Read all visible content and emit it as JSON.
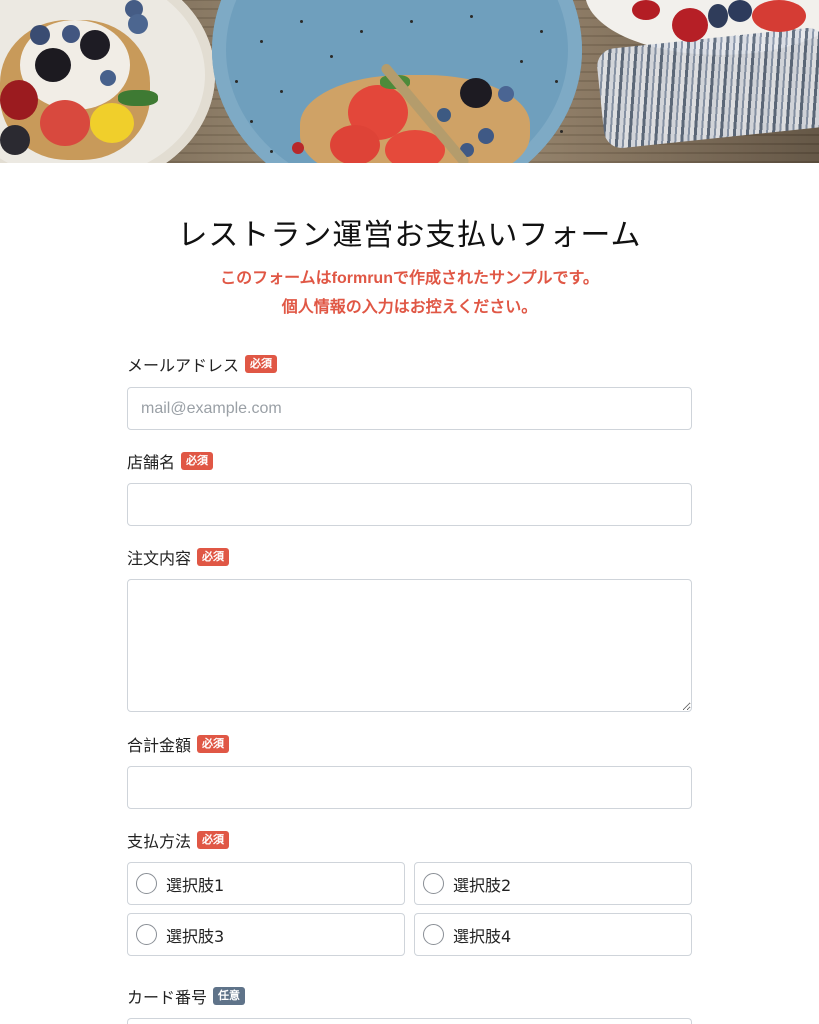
{
  "form": {
    "title": "レストラン運営お支払いフォーム",
    "notice_line1_prefix": "このフォームは",
    "notice_brand": "formrun",
    "notice_line1_suffix": "で作成されたサンプルです。",
    "notice_line2": "個人情報の入力はお控えください。"
  },
  "badges": {
    "required": "必須",
    "optional": "任意"
  },
  "fields": {
    "email": {
      "label": "メールアドレス",
      "placeholder": "mail@example.com",
      "value": ""
    },
    "store_name": {
      "label": "店舗名",
      "value": ""
    },
    "order_details": {
      "label": "注文内容",
      "value": ""
    },
    "total_amount": {
      "label": "合計金額",
      "value": ""
    },
    "payment_method": {
      "label": "支払方法",
      "options": [
        "選択肢1",
        "選択肢2",
        "選択肢3",
        "選択肢4"
      ]
    },
    "card_number": {
      "label": "カード番号",
      "value": ""
    }
  },
  "colors": {
    "accent": "#e05745",
    "optional_badge": "#5f7389",
    "border": "#cfd4da"
  }
}
